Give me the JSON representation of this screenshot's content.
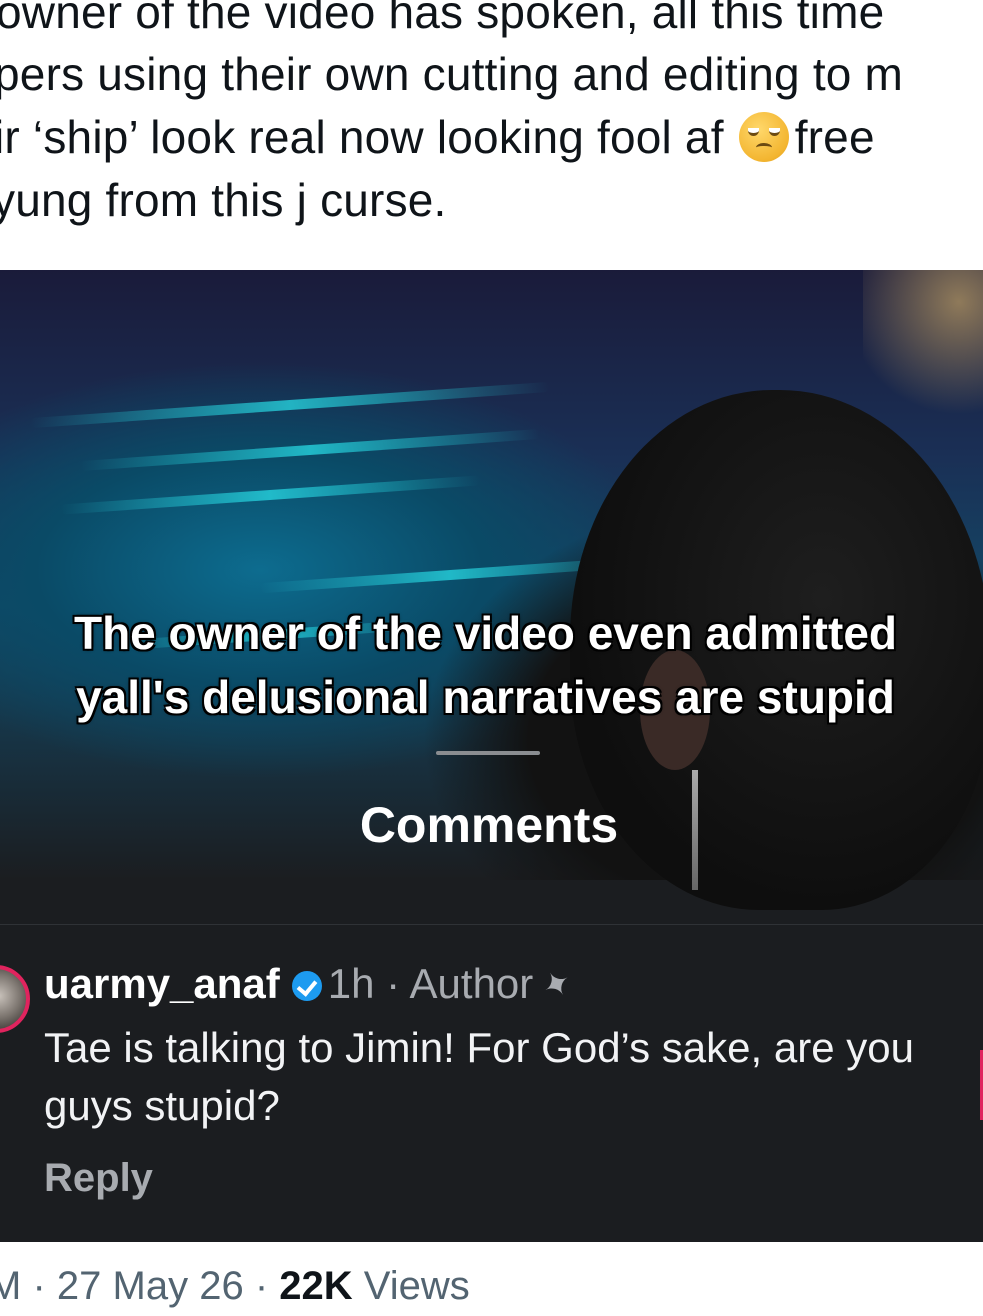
{
  "tweet": {
    "lines": [
      "owner of the video has spoken, all this time",
      "pers using their own cutting and editing to m",
      "ir ‘ship’ look real now looking fool af",
      "free",
      "yung from this j curse."
    ]
  },
  "video": {
    "caption_line1": "The owner of the video even admitted",
    "caption_line2": "yall's delusional narratives are stupid"
  },
  "comments_panel": {
    "title": "Comments",
    "comment": {
      "username": "uarmy_anaf",
      "time": "1h",
      "separator": "·",
      "role": "Author",
      "text": "Tae is talking to Jimin! For God’s sake, are you guys stupid?",
      "reply_label": "Reply"
    }
  },
  "footer": {
    "time_prefix": "M",
    "separator": "·",
    "date": "27 May 26",
    "views_count": "22K",
    "views_label": "Views"
  },
  "colors": {
    "accent_blue": "#1d9bf0",
    "panel_bg": "#1b1d20",
    "avatar_ring": "#e0245e"
  }
}
